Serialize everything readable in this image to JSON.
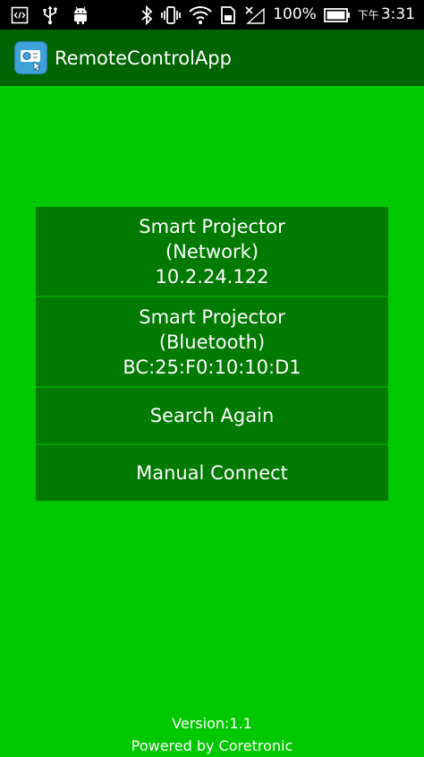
{
  "status_bar": {
    "battery_percent": "100%",
    "time_prefix": "下午",
    "time": "3:31",
    "icons": [
      "developer-code-icon",
      "usb-icon",
      "android-icon",
      "bluetooth-icon",
      "vibrate-icon",
      "wifi-icon",
      "sim-icon",
      "no-signal-icon",
      "battery-icon"
    ]
  },
  "app_bar": {
    "title": "RemoteControlApp"
  },
  "devices": [
    {
      "name_line1": "Smart Projector",
      "name_line2": "(Network)",
      "address": "10.2.24.122"
    },
    {
      "name_line1": "Smart Projector",
      "name_line2": "(Bluetooth)",
      "address": "BC:25:F0:10:10:D1"
    }
  ],
  "actions": {
    "search_again": "Search Again",
    "manual_connect": "Manual Connect"
  },
  "footer": {
    "version": "Version:1.1",
    "powered_by": "Powered by Coretronic"
  },
  "colors": {
    "background": "#00c800",
    "app_bar": "#006400",
    "button": "#007a00",
    "status_bar": "#000000"
  }
}
